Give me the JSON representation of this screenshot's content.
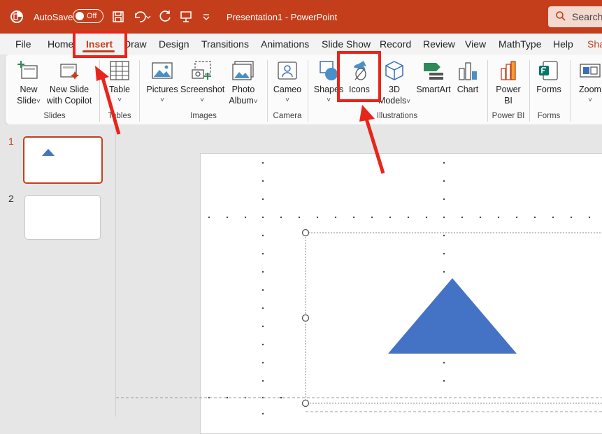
{
  "titlebar": {
    "autosave_label": "AutoSave",
    "autosave_state": "Off",
    "document_title": "Presentation1  -  PowerPoint",
    "search_label": "Search"
  },
  "tabs": {
    "file": "File",
    "home": "Home",
    "insert": "Insert",
    "draw": "Draw",
    "design": "Design",
    "transitions": "Transitions",
    "animations": "Animations",
    "slideshow": "Slide Show",
    "record": "Record",
    "review": "Review",
    "view": "View",
    "mathtype": "MathType",
    "help": "Help",
    "share": "Sha"
  },
  "ribbon": {
    "new_slide_1": "New",
    "new_slide_2": "Slide",
    "copilot_1": "New Slide",
    "copilot_2": "with Copilot",
    "slides_group": "Slides",
    "table": "Table",
    "tables_group": "Tables",
    "pictures": "Pictures",
    "screenshot": "Screenshot",
    "photo_album_1": "Photo",
    "photo_album_2": "Album",
    "images_group": "Images",
    "cameo": "Cameo",
    "camera_group": "Camera",
    "shapes": "Shapes",
    "icons": "Icons",
    "models_1": "3D",
    "models_2": "Models",
    "smartart": "SmartArt",
    "chart": "Chart",
    "illustrations_group": "Illustrations",
    "powerbi_1": "Power",
    "powerbi_2": "BI",
    "powerbi_group": "Power BI",
    "forms": "Forms",
    "forms_group": "Forms",
    "zoom": "Zoom"
  },
  "slides_panel": {
    "slide1_number": "1",
    "slide2_number": "2"
  },
  "colors": {
    "accent": "#c43e1c",
    "annotation_red": "#e8251b",
    "shape_blue": "#4472c4"
  }
}
